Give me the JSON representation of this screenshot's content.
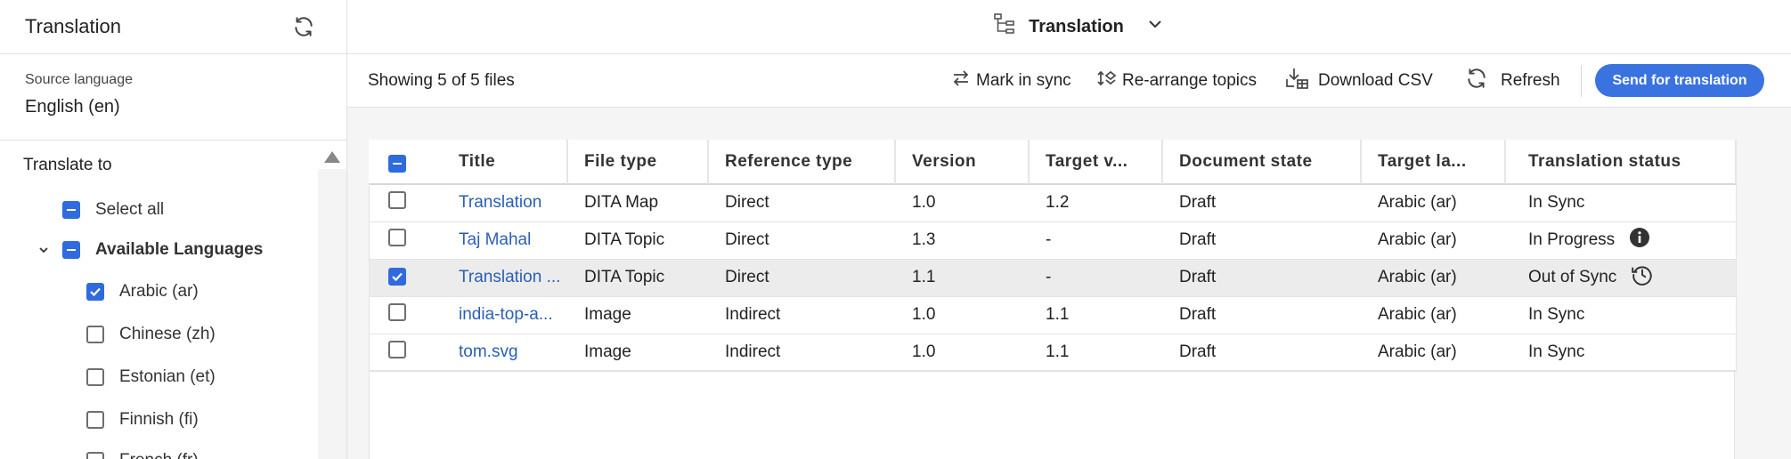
{
  "left_panel": {
    "title": "Translation",
    "refresh_icon": "refresh-icon",
    "source_language_label": "Source language",
    "source_language_value": "English (en)",
    "translate_to_label": "Translate to",
    "select_all_label": "Select all",
    "group_label": "Available Languages",
    "languages": [
      {
        "label": "Arabic (ar)",
        "checked": true
      },
      {
        "label": "Chinese (zh)",
        "checked": false
      },
      {
        "label": "Estonian (et)",
        "checked": false
      },
      {
        "label": "Finnish (fi)",
        "checked": false
      },
      {
        "label": "French (fr)",
        "checked": false
      }
    ]
  },
  "topbar": {
    "title": "Translation",
    "icon": "hierarchy-icon"
  },
  "toolbar": {
    "showing_text": "Showing 5 of 5 files",
    "mark_in_sync": "Mark in sync",
    "rearrange_topics": "Re-arrange topics",
    "download_csv": "Download CSV",
    "refresh": "Refresh",
    "send_for_translation": "Send for translation"
  },
  "table": {
    "columns": [
      "Title",
      "File type",
      "Reference type",
      "Version",
      "Target v...",
      "Document state",
      "Target la...",
      "Translation status"
    ],
    "rows": [
      {
        "checked": false,
        "title": "Translation",
        "file_type": "DITA Map",
        "reference_type": "Direct",
        "version": "1.0",
        "target_version": "1.2",
        "document_state": "Draft",
        "target_language": "Arabic (ar)",
        "translation_status": "In Sync",
        "status_icon": ""
      },
      {
        "checked": false,
        "title": "Taj Mahal",
        "file_type": "DITA Topic",
        "reference_type": "Direct",
        "version": "1.3",
        "target_version": "-",
        "document_state": "Draft",
        "target_language": "Arabic (ar)",
        "translation_status": "In Progress",
        "status_icon": "info-icon"
      },
      {
        "checked": true,
        "title": "Translation ...",
        "file_type": "DITA Topic",
        "reference_type": "Direct",
        "version": "1.1",
        "target_version": "-",
        "document_state": "Draft",
        "target_language": "Arabic (ar)",
        "translation_status": "Out of Sync",
        "status_icon": "history-icon"
      },
      {
        "checked": false,
        "title": "india-top-a...",
        "file_type": "Image",
        "reference_type": "Indirect",
        "version": "1.0",
        "target_version": "1.1",
        "document_state": "Draft",
        "target_language": "Arabic (ar)",
        "translation_status": "In Sync",
        "status_icon": ""
      },
      {
        "checked": false,
        "title": "tom.svg",
        "file_type": "Image",
        "reference_type": "Indirect",
        "version": "1.0",
        "target_version": "1.1",
        "document_state": "Draft",
        "target_language": "Arabic (ar)",
        "translation_status": "In Sync",
        "status_icon": ""
      }
    ]
  },
  "colors": {
    "accent": "#3a73e0",
    "link": "#2a5fb5",
    "selected_row": "#ececec"
  }
}
